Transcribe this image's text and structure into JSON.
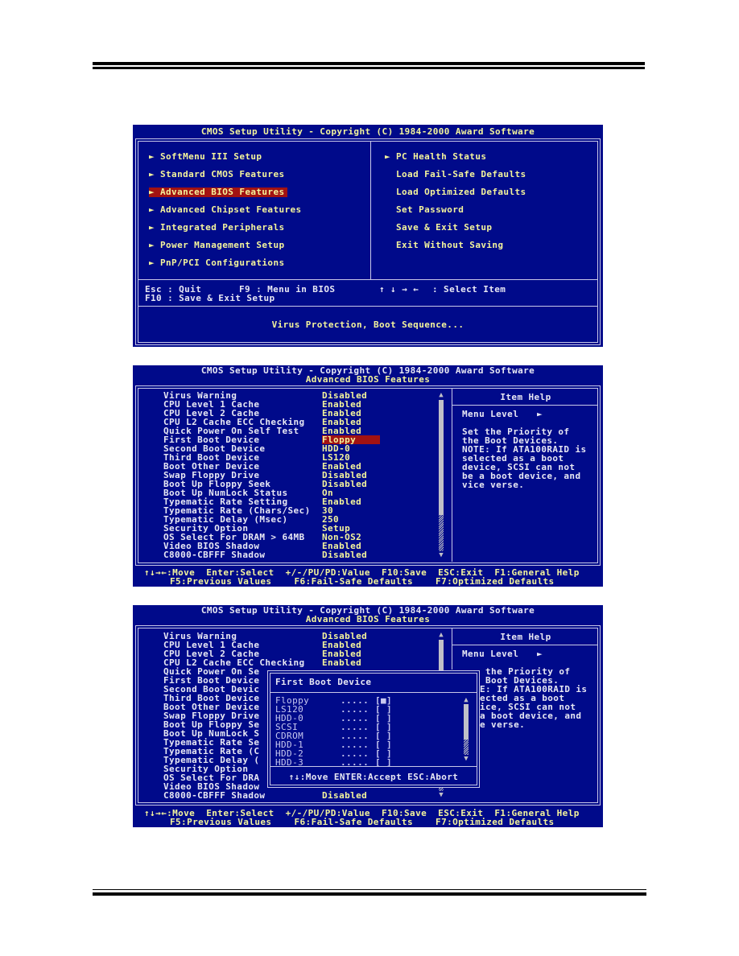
{
  "screen1": {
    "title": "CMOS Setup Utility - Copyright (C) 1984-2000 Award Software",
    "left_menu": [
      {
        "label": "SoftMenu III Setup",
        "arrow": true,
        "selected": false
      },
      {
        "label": "Standard CMOS Features",
        "arrow": true,
        "selected": false
      },
      {
        "label": "Advanced BIOS Features",
        "arrow": true,
        "selected": true
      },
      {
        "label": "Advanced Chipset Features",
        "arrow": true,
        "selected": false
      },
      {
        "label": "Integrated Peripherals",
        "arrow": true,
        "selected": false
      },
      {
        "label": "Power Management Setup",
        "arrow": true,
        "selected": false
      },
      {
        "label": "PnP/PCI Configurations",
        "arrow": true,
        "selected": false
      }
    ],
    "right_menu": [
      {
        "label": "PC Health Status",
        "arrow": true
      },
      {
        "label": "Load Fail-Safe Defaults",
        "arrow": false
      },
      {
        "label": "Load Optimized Defaults",
        "arrow": false
      },
      {
        "label": "Set Password",
        "arrow": false
      },
      {
        "label": "Save & Exit Setup",
        "arrow": false
      },
      {
        "label": "Exit Without Saving",
        "arrow": false
      }
    ],
    "arrow_glyph": "►",
    "keys": {
      "esc": "Esc : Quit",
      "f9": "F9 : Menu in BIOS",
      "arrows": "↑ ↓ → ←",
      "select": ": Select Item",
      "f10": "F10 : Save & Exit Setup"
    },
    "status": "Virus Protection, Boot Sequence..."
  },
  "screen2": {
    "title": "CMOS Setup Utility - Copyright (C) 1984-2000 Award Software",
    "subtitle": "Advanced BIOS Features",
    "settings": [
      {
        "label": "Virus Warning",
        "value": "Disabled"
      },
      {
        "label": "CPU Level 1 Cache",
        "value": "Enabled"
      },
      {
        "label": "CPU Level 2 Cache",
        "value": "Enabled"
      },
      {
        "label": "CPU L2 Cache ECC Checking",
        "value": "Enabled"
      },
      {
        "label": "Quick Power On Self Test",
        "value": "Enabled"
      },
      {
        "label": "First Boot Device",
        "value": "Floppy"
      },
      {
        "label": "Second Boot Device",
        "value": "HDD-0"
      },
      {
        "label": "Third Boot Device",
        "value": "LS120"
      },
      {
        "label": "Boot Other Device",
        "value": "Enabled"
      },
      {
        "label": "Swap Floppy Drive",
        "value": "Disabled"
      },
      {
        "label": "Boot Up Floppy Seek",
        "value": "Disabled"
      },
      {
        "label": "Boot Up NumLock Status",
        "value": "On"
      },
      {
        "label": "Typematic Rate Setting",
        "value": "Enabled"
      },
      {
        "label": "Typematic Rate (Chars/Sec)",
        "value": "30"
      },
      {
        "label": "Typematic Delay (Msec)",
        "value": "250"
      },
      {
        "label": "Security Option",
        "value": "Setup"
      },
      {
        "label": "OS Select For DRAM > 64MB",
        "value": "Non-OS2"
      },
      {
        "label": "Video BIOS Shadow",
        "value": "Enabled"
      },
      {
        "label": "C8000-CBFFF Shadow",
        "value": "Disabled"
      }
    ],
    "selected_index": 5,
    "help": {
      "title": "Item Help",
      "menu_level": "Menu Level",
      "menu_level_glyph": "►",
      "lines": [
        "Set the Priority of",
        "the Boot Devices.",
        "NOTE: If ATA100RAID is",
        "selected as a boot",
        "device, SCSI can not",
        "be a boot device, and",
        "vice verse."
      ]
    },
    "footer": {
      "line1": "↑↓→←:Move  Enter:Select  +/-/PU/PD:Value  F10:Save  ESC:Exit  F1:General Help",
      "line2": "F5:Previous Values    F6:Fail-Safe Defaults    F7:Optimized Defaults"
    }
  },
  "screen3": {
    "title": "CMOS Setup Utility - Copyright (C) 1984-2000 Award Software",
    "subtitle": "Advanced BIOS Features",
    "settings_visible": [
      {
        "label": "Virus Warning",
        "value": "Disabled"
      },
      {
        "label": "CPU Level 1 Cache",
        "value": "Enabled"
      },
      {
        "label": "CPU Level 2 Cache",
        "value": "Enabled"
      },
      {
        "label": "CPU L2 Cache ECC Checking",
        "value": "Enabled"
      },
      {
        "label": "Quick Power On Se",
        "value": ""
      },
      {
        "label": "First Boot Device",
        "value": ""
      },
      {
        "label": "Second Boot Devic",
        "value": ""
      },
      {
        "label": "Third Boot Device",
        "value": ""
      },
      {
        "label": "Boot Other Device",
        "value": ""
      },
      {
        "label": "Swap Floppy Drive",
        "value": ""
      },
      {
        "label": "Boot Up Floppy Se",
        "value": ""
      },
      {
        "label": "Boot Up NumLock S",
        "value": ""
      },
      {
        "label": "Typematic Rate Se",
        "value": ""
      },
      {
        "label": "Typematic Rate (C",
        "value": ""
      },
      {
        "label": "Typematic Delay (",
        "value": ""
      },
      {
        "label": "Security Option",
        "value": ""
      },
      {
        "label": "OS Select For DRA",
        "value": ""
      },
      {
        "label": "Video BIOS Shadow",
        "value": ""
      },
      {
        "label": "C8000-CBFFF Shadow",
        "value": "Disabled"
      }
    ],
    "help": {
      "title": "Item Help",
      "menu_level": "Menu Level",
      "menu_level_glyph": "►",
      "lines": [
        " the Priority of",
        " Boot Devices.",
        "E: If ATA100RAID is",
        "ected as a boot",
        "ice, SCSI can not",
        "a boot device, and",
        "e verse."
      ]
    },
    "popup": {
      "title": "First Boot Device",
      "options": [
        {
          "label": "Floppy",
          "dots": ".....",
          "checked": true
        },
        {
          "label": "LS120",
          "dots": ".....",
          "checked": false
        },
        {
          "label": "HDD-0",
          "dots": ".....",
          "checked": false
        },
        {
          "label": "SCSI",
          "dots": ".....",
          "checked": false
        },
        {
          "label": "CDROM",
          "dots": ".....",
          "checked": false
        },
        {
          "label": "HDD-1",
          "dots": ".....",
          "checked": false
        },
        {
          "label": "HDD-2",
          "dots": ".....",
          "checked": false
        },
        {
          "label": "HDD-3",
          "dots": ".....",
          "checked": false
        }
      ],
      "checked_mark": "[■]",
      "unchecked_mark": "[ ]",
      "footer": "↑↓:Move ENTER:Accept ESC:Abort"
    },
    "footer": {
      "line1": "↑↓→←:Move  Enter:Select  +/-/PU/PD:Value  F10:Save  ESC:Exit  F1:General Help",
      "line2": "F5:Previous Values    F6:Fail-Safe Defaults    F7:Optimized Defaults"
    }
  },
  "colors": {
    "bios_blue": "#000a8a",
    "text_yellow": "#f4f49c",
    "text_white": "#e8e8f4",
    "highlight_red": "#a21212",
    "frame": "#c8c8e8"
  }
}
